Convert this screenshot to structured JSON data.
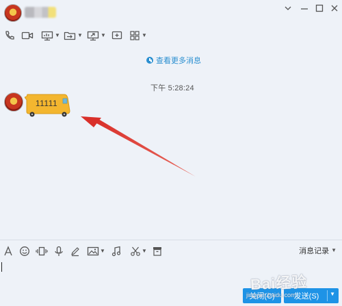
{
  "titlebar": {
    "contact_name": ""
  },
  "history": {
    "more_messages": "查看更多消息",
    "timestamp": "下午 5:28:24"
  },
  "message": {
    "text": "11111"
  },
  "input_toolbar": {
    "history_label": "消息记录"
  },
  "buttons": {
    "close_label": "关闭(C)",
    "send_label": "发送(S)"
  },
  "watermark": {
    "brand": "Bai经验",
    "url": "jingyan.baidu.com"
  },
  "colors": {
    "accent": "#1e93e6",
    "link": "#2a8fd0",
    "arrow": "#e0443a",
    "bubble": "#f3b62f"
  }
}
